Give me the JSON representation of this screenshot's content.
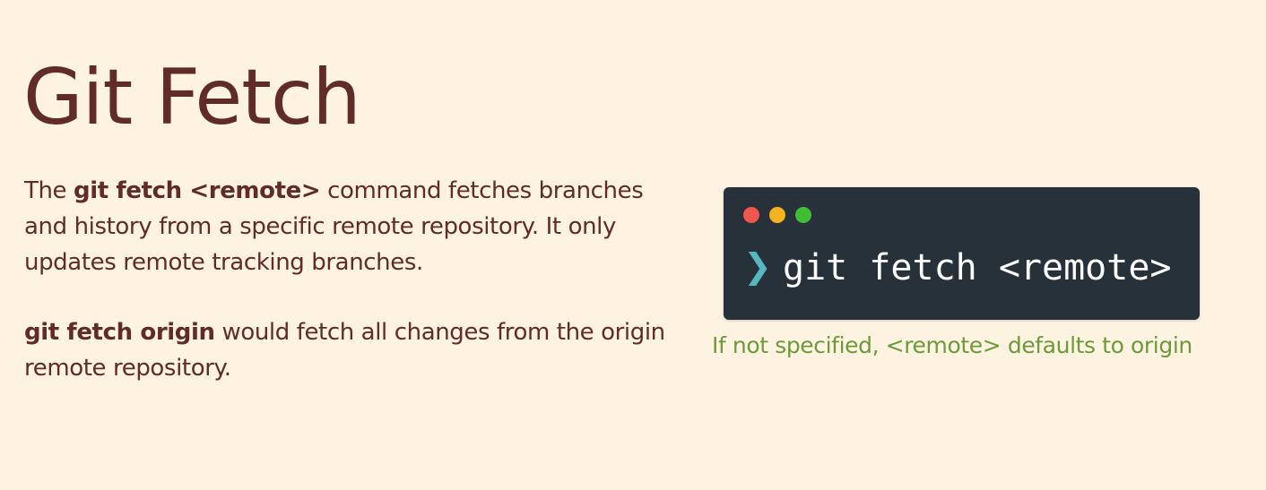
{
  "title": "Git Fetch",
  "paragraph1": {
    "pre": "The ",
    "bold": "git fetch <remote>",
    "post": " command fetches branches and history from a specific remote repository.  It only updates remote tracking branches."
  },
  "paragraph2": {
    "bold": "git fetch origin",
    "post": " would fetch all changes from the origin remote repository."
  },
  "terminal": {
    "prompt_glyph": "❯",
    "command": "git fetch <remote>",
    "dot_colors": {
      "red": "#F0554E",
      "yellow": "#F6B21C",
      "green": "#3FBE33"
    }
  },
  "caption": "If not specified, <remote> defaults to origin",
  "colors": {
    "background": "#FEF2E1",
    "text": "#612B2A",
    "terminal_bg": "#263139",
    "prompt": "#57B6BE",
    "caption": "#6B9B3A"
  }
}
